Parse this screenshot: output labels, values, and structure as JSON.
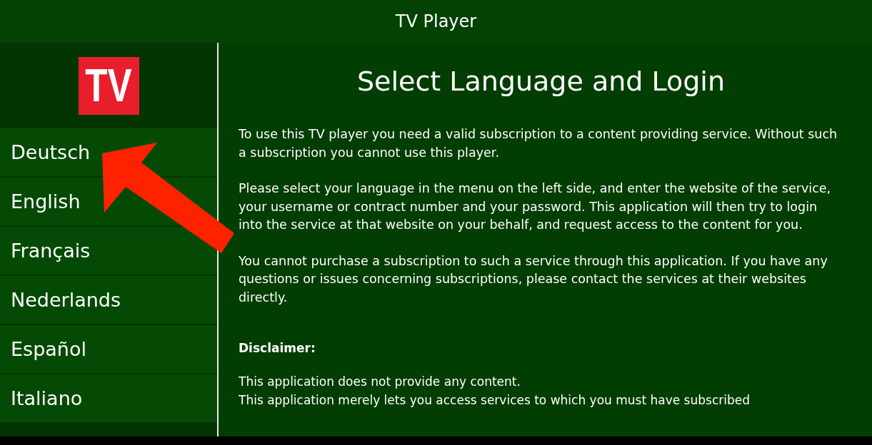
{
  "window": {
    "title": "TV Player"
  },
  "sidebar": {
    "logo": "TV",
    "items": [
      {
        "label": "Deutsch"
      },
      {
        "label": "English"
      },
      {
        "label": "Français"
      },
      {
        "label": "Nederlands"
      },
      {
        "label": "Español"
      },
      {
        "label": "Italiano"
      }
    ]
  },
  "content": {
    "heading": "Select Language and Login",
    "paragraphs": [
      "To use this TV player you need a valid subscription to a content providing service. Without such a subscription you cannot use this player.",
      "Please select your language in the menu on the left side, and enter the website of the service, your username or contract number and your password. This application will then try to login into the service at that website on your behalf, and request access to the content for you.",
      "You cannot purchase a subscription to such a service through this application. If you have any questions or issues concerning subscriptions, please contact the services at their websites directly."
    ],
    "disclaimer_heading": "Disclaimer:",
    "disclaimer_lines": [
      "This application does not provide any content.",
      "This application merely lets you access services to which you must have subscribed"
    ]
  },
  "annotation": {
    "kind": "arrow"
  }
}
